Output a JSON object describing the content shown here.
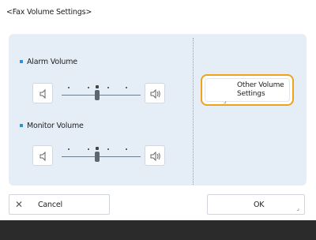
{
  "title": "<Fax Volume Settings>",
  "alarm": {
    "label": "Alarm Volume",
    "level": 2,
    "max_level": 5,
    "decrease_icon": "speaker-quiet-icon",
    "increase_icon": "speaker-loud-icon"
  },
  "monitor": {
    "label": "Monitor Volume",
    "level": 2,
    "max_level": 5,
    "decrease_icon": "speaker-quiet-icon",
    "increase_icon": "speaker-loud-icon"
  },
  "other_button": {
    "line1": "Other Volume",
    "line2": "Settings"
  },
  "buttons": {
    "cancel": "Cancel",
    "ok": "OK"
  },
  "colors": {
    "panel": "#e5eef6",
    "accent": "#2d8fd5",
    "focus": "#f0a21b",
    "footer": "#2b2b2b"
  }
}
